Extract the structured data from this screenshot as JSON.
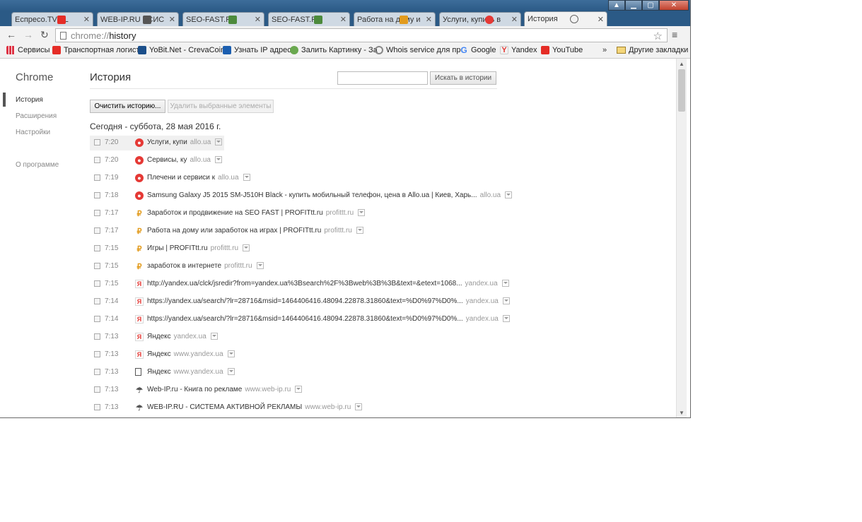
{
  "tabs": [
    {
      "title": "Eспресо.TV - L",
      "favicon": "youtube-icon",
      "color": "#e52d27"
    },
    {
      "title": "WEB-IP.RU - СИС",
      "favicon": "web-ip-icon",
      "color": "#555555"
    },
    {
      "title": "SEO-FAST.RU",
      "favicon": "seo-fast-icon",
      "color": "#4c8a3c"
    },
    {
      "title": "SEO-FAST.RU",
      "favicon": "seo-fast-icon",
      "color": "#4c8a3c"
    },
    {
      "title": "Работа на дому и",
      "favicon": "profit-icon",
      "color": "#e29b1d"
    },
    {
      "title": "Услуги, купить в",
      "favicon": "allo-icon",
      "color": "#e53935"
    },
    {
      "title": "История",
      "favicon": "history-icon",
      "color": "#666666",
      "active": true
    }
  ],
  "omnibox": {
    "scheme": "chrome://",
    "host": "history"
  },
  "bookmarks": [
    {
      "label": "Сервисы",
      "icon": "apps-grid-icon"
    },
    {
      "label": "Транспортная логист",
      "icon": "youtube-icon"
    },
    {
      "label": "YoBit.Net - CrevaCoin",
      "icon": "yobit-icon"
    },
    {
      "label": "Узнать IP адрес",
      "icon": "ip-icon"
    },
    {
      "label": "Залить Картинку - За",
      "icon": "leaf-icon"
    },
    {
      "label": "Whois service для пр",
      "icon": "magnifier-icon"
    },
    {
      "label": "Google",
      "icon": "google-icon"
    },
    {
      "label": "Yandex",
      "icon": "yandex-icon"
    },
    {
      "label": "YouTube",
      "icon": "youtube-icon"
    }
  ],
  "bookmarks_overflow": "»",
  "other_bookmarks": "Другие закладки",
  "sidebar": {
    "logo": "Chrome",
    "items": [
      "История",
      "Расширения",
      "Настройки"
    ],
    "about": "О программе"
  },
  "history": {
    "title": "История",
    "search_button": "Искать в истории",
    "clear_button": "Очистить историю...",
    "remove_button": "Удалить выбранные элементы",
    "day_header": "Сегодня - суббота, 28 мая 2016 г.",
    "entries": [
      {
        "time": "7:20",
        "title": "Услуги, купи",
        "domain": "allo.ua",
        "favicon": "allo-icon"
      },
      {
        "time": "7:20",
        "title": "Сервисы, ку",
        "domain": "allo.ua",
        "favicon": "allo-icon"
      },
      {
        "time": "7:19",
        "title": "Плечени и сервиси к",
        "domain": "allo.ua",
        "favicon": "allo-icon"
      },
      {
        "time": "7:18",
        "title": "Samsung Galaxy J5 2015 SM-J510H Black - купить мобильный телефон, цена в Allo.ua | Киев, Харь...",
        "domain": "allo.ua",
        "favicon": "allo-icon"
      },
      {
        "time": "7:17",
        "title": "Заработок и продвижение на SEO FAST | PROFITtt.ru",
        "domain": "profittt.ru",
        "favicon": "profit-icon"
      },
      {
        "time": "7:17",
        "title": "Работа на дому или заработок на играх | PROFITtt.ru",
        "domain": "profittt.ru",
        "favicon": "profit-icon"
      },
      {
        "time": "7:15",
        "title": "Игры | PROFITtt.ru",
        "domain": "profittt.ru",
        "favicon": "profit-icon"
      },
      {
        "time": "7:15",
        "title": "заработок в интернете",
        "domain": "profittt.ru",
        "favicon": "profit-icon"
      },
      {
        "time": "7:15",
        "title": "http://yandex.ua/clck/jsredir?from=yandex.ua%3Bsearch%2F%3Bweb%3B%3B&text=&etext=1068...",
        "domain": "yandex.ua",
        "favicon": "yandex-icon"
      },
      {
        "time": "7:14",
        "title": "https://yandex.ua/search/?lr=28716&msid=1464406416.48094.22878.31860&text=%D0%97%D0%...",
        "domain": "yandex.ua",
        "favicon": "yandex-icon"
      },
      {
        "time": "7:14",
        "title": "https://yandex.ua/search/?lr=28716&msid=1464406416.48094.22878.31860&text=%D0%97%D0%...",
        "domain": "yandex.ua",
        "favicon": "yandex-icon"
      },
      {
        "time": "7:13",
        "title": "Яндекс",
        "domain": "yandex.ua",
        "favicon": "yandex-icon"
      },
      {
        "time": "7:13",
        "title": "Яндекс",
        "domain": "www.yandex.ua",
        "favicon": "yandex-icon"
      },
      {
        "time": "7:13",
        "title": "Яндекс",
        "domain": "www.yandex.ua",
        "favicon": "document-icon"
      },
      {
        "time": "7:13",
        "title": "Web-IP.ru - Книга по рекламе",
        "domain": "www.web-ip.ru",
        "favicon": "web-ip-icon"
      },
      {
        "time": "7:13",
        "title": "WEB-IP.RU - СИСТЕМА АКТИВНОЙ РЕКЛАМЫ",
        "domain": "www.web-ip.ru",
        "favicon": "web-ip-icon"
      }
    ]
  }
}
